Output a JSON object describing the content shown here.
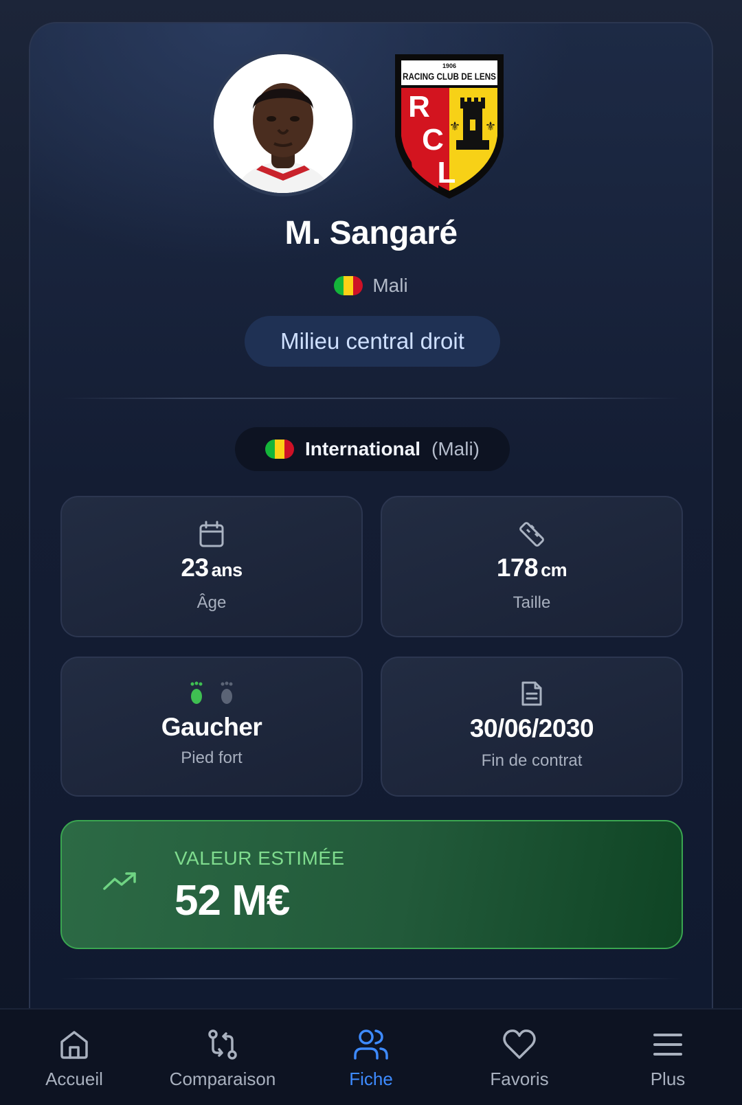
{
  "player": {
    "name": "M. Sangaré",
    "nationality": "Mali",
    "position": "Milieu central droit"
  },
  "club": {
    "logo_year": "1906",
    "logo_name": "RACING CLUB DE LENS",
    "logo_letters": [
      "R",
      "C",
      "L"
    ]
  },
  "international": {
    "label": "International",
    "country": "(Mali)"
  },
  "flag_colors": [
    "#14b53a",
    "#fcd116",
    "#ce1126"
  ],
  "stats": {
    "age": {
      "value": "23",
      "unit": "ans",
      "label": "Âge",
      "icon": "calendar-icon"
    },
    "height": {
      "value": "178",
      "unit": "cm",
      "label": "Taille",
      "icon": "ruler-icon"
    },
    "foot": {
      "value": "Gaucher",
      "label": "Pied fort",
      "icon": "footprints-icon"
    },
    "contract": {
      "value": "30/06/2030",
      "label": "Fin de contrat",
      "icon": "document-icon"
    }
  },
  "market_value": {
    "caption": "VALEUR ESTIMÉE",
    "amount": "52 M€",
    "icon": "trending-up-icon"
  },
  "nav": {
    "items": [
      {
        "label": "Accueil",
        "icon": "home-icon",
        "active": false
      },
      {
        "label": "Comparaison",
        "icon": "compare-icon",
        "active": false
      },
      {
        "label": "Fiche",
        "icon": "users-icon",
        "active": true
      },
      {
        "label": "Favoris",
        "icon": "heart-icon",
        "active": false
      },
      {
        "label": "Plus",
        "icon": "menu-icon",
        "active": false
      }
    ]
  },
  "colors": {
    "accent": "#3e8bff",
    "value_green": "#7fdc8e",
    "left_foot": "#3fbf52",
    "right_foot": "#5b6476"
  }
}
